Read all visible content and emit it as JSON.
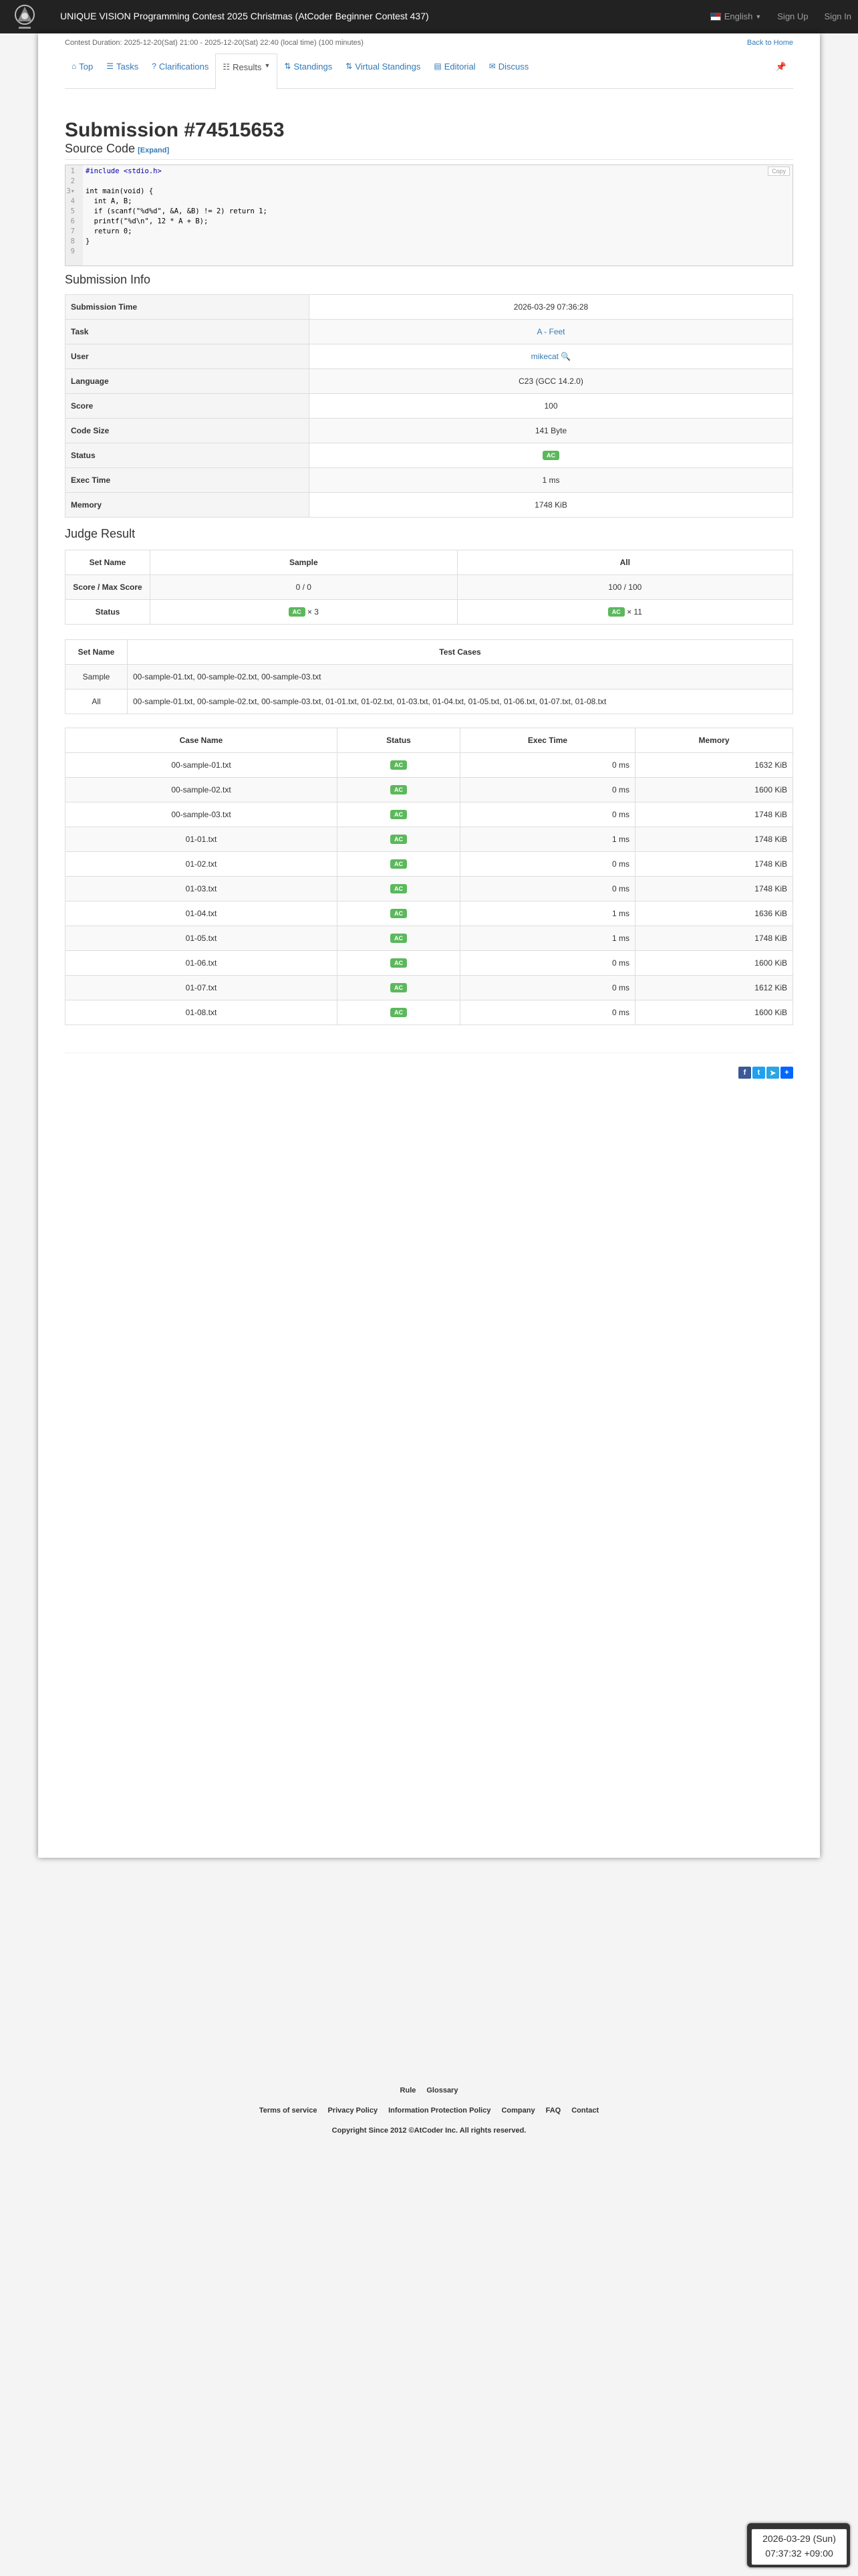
{
  "header": {
    "contest_title": "UNIQUE VISION Programming Contest 2025 Christmas (AtCoder Beginner Contest 437)",
    "language": "English",
    "sign_up": "Sign Up",
    "sign_in": "Sign In"
  },
  "contest": {
    "duration": "Contest Duration: 2025-12-20(Sat) 21:00 - 2025-12-20(Sat) 22:40 (local time) (100 minutes)",
    "back_home": "Back to Home"
  },
  "tabs": [
    {
      "label": "Top",
      "icon": "home-icon"
    },
    {
      "label": "Tasks",
      "icon": "list-icon"
    },
    {
      "label": "Clarifications",
      "icon": "question-circle-icon"
    },
    {
      "label": "Results",
      "icon": "results-list-icon"
    },
    {
      "label": "Standings",
      "icon": "sort-icon"
    },
    {
      "label": "Virtual Standings",
      "icon": "sort-icon"
    },
    {
      "label": "Editorial",
      "icon": "book-icon"
    },
    {
      "label": "Discuss",
      "icon": "comment-icon"
    }
  ],
  "submission": {
    "title": "Submission #74515653",
    "source_code_heading": "Source Code",
    "expand": "[Expand]",
    "copy": "Copy",
    "code_lines": [
      "#include <stdio.h>",
      "",
      "int main(void) {",
      "  int A, B;",
      "  if (scanf(\"%d%d\", &A, &B) != 2) return 1;",
      "  printf(\"%d\\n\", 12 * A + B);",
      "  return 0;",
      "}",
      ""
    ],
    "info_heading": "Submission Info",
    "info": [
      {
        "label": "Submission Time",
        "value": "2026-03-29 07:36:28"
      },
      {
        "label": "Task",
        "value": "A - Feet"
      },
      {
        "label": "User",
        "value": "mikecat"
      },
      {
        "label": "Language",
        "value": "C23 (GCC 14.2.0)"
      },
      {
        "label": "Score",
        "value": "100"
      },
      {
        "label": "Code Size",
        "value": "141 Byte"
      },
      {
        "label": "Status",
        "value": "AC"
      },
      {
        "label": "Exec Time",
        "value": "1 ms"
      },
      {
        "label": "Memory",
        "value": "1748 KiB"
      }
    ]
  },
  "judge": {
    "heading": "Judge Result",
    "cols": [
      "Set Name",
      "Sample",
      "All"
    ],
    "score_label": "Score / Max Score",
    "sample_score": "0 / 0",
    "all_score": "100 / 100",
    "status_label": "Status",
    "ac": "AC",
    "sample_count": "× 3",
    "all_count": "× 11",
    "sets_cols": [
      "Set Name",
      "Test Cases"
    ],
    "sets": [
      {
        "name": "Sample",
        "cases": "00-sample-01.txt, 00-sample-02.txt, 00-sample-03.txt"
      },
      {
        "name": "All",
        "cases": "00-sample-01.txt, 00-sample-02.txt, 00-sample-03.txt, 01-01.txt, 01-02.txt, 01-03.txt, 01-04.txt, 01-05.txt, 01-06.txt, 01-07.txt, 01-08.txt"
      }
    ],
    "case_cols": [
      "Case Name",
      "Status",
      "Exec Time",
      "Memory"
    ],
    "cases": [
      {
        "name": "00-sample-01.txt",
        "status": "AC",
        "time": "0 ms",
        "memory": "1632 KiB"
      },
      {
        "name": "00-sample-02.txt",
        "status": "AC",
        "time": "0 ms",
        "memory": "1600 KiB"
      },
      {
        "name": "00-sample-03.txt",
        "status": "AC",
        "time": "0 ms",
        "memory": "1748 KiB"
      },
      {
        "name": "01-01.txt",
        "status": "AC",
        "time": "1 ms",
        "memory": "1748 KiB"
      },
      {
        "name": "01-02.txt",
        "status": "AC",
        "time": "0 ms",
        "memory": "1748 KiB"
      },
      {
        "name": "01-03.txt",
        "status": "AC",
        "time": "0 ms",
        "memory": "1748 KiB"
      },
      {
        "name": "01-04.txt",
        "status": "AC",
        "time": "1 ms",
        "memory": "1636 KiB"
      },
      {
        "name": "01-05.txt",
        "status": "AC",
        "time": "1 ms",
        "memory": "1748 KiB"
      },
      {
        "name": "01-06.txt",
        "status": "AC",
        "time": "0 ms",
        "memory": "1600 KiB"
      },
      {
        "name": "01-07.txt",
        "status": "AC",
        "time": "0 ms",
        "memory": "1612 KiB"
      },
      {
        "name": "01-08.txt",
        "status": "AC",
        "time": "0 ms",
        "memory": "1600 KiB"
      }
    ]
  },
  "footer": {
    "links1": [
      "Rule",
      "Glossary"
    ],
    "links2": [
      "Terms of service",
      "Privacy Policy",
      "Information Protection Policy",
      "Company",
      "FAQ",
      "Contact"
    ],
    "copyright": "Copyright Since 2012 ©AtCoder Inc. All rights reserved."
  },
  "clock": {
    "date": "2026-03-29 (Sun)",
    "time": "07:37:32 +09:00"
  },
  "colors": {
    "navbar": "#222222",
    "link": "#337ab7",
    "ac_badge": "#5cb85c"
  }
}
